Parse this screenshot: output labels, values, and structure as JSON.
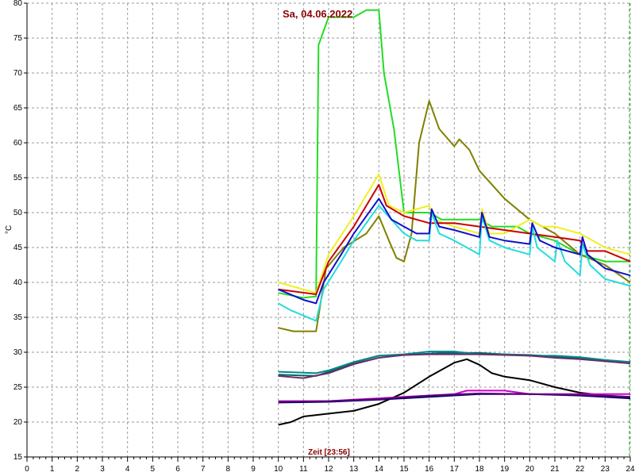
{
  "chart_data": {
    "type": "line",
    "title": "Sa, 04.06.2022",
    "xlabel": "Zeit [23:56]",
    "ylabel": "°C",
    "xlim": [
      0,
      24
    ],
    "ylim": [
      15,
      80
    ],
    "x_ticks": [
      0,
      1,
      2,
      3,
      4,
      5,
      6,
      7,
      8,
      9,
      10,
      11,
      12,
      13,
      14,
      15,
      16,
      17,
      18,
      19,
      20,
      21,
      22,
      23,
      24
    ],
    "y_ticks": [
      15,
      20,
      25,
      30,
      35,
      40,
      45,
      50,
      55,
      60,
      65,
      70,
      75,
      80
    ],
    "grid": true,
    "series": [
      {
        "color": "#22dd22",
        "points": [
          [
            10,
            38.5
          ],
          [
            11,
            37.8
          ],
          [
            11.5,
            38
          ],
          [
            11.6,
            74
          ],
          [
            11.9,
            77
          ],
          [
            12,
            78
          ],
          [
            13,
            78
          ],
          [
            13.5,
            79
          ],
          [
            14,
            79
          ],
          [
            14.2,
            70
          ],
          [
            14.6,
            62
          ],
          [
            15,
            50
          ],
          [
            16,
            50
          ],
          [
            16.5,
            49
          ],
          [
            17,
            49
          ],
          [
            18,
            49
          ],
          [
            18.5,
            48
          ],
          [
            19,
            48
          ],
          [
            19.5,
            48
          ],
          [
            20,
            47
          ],
          [
            21,
            46
          ],
          [
            22,
            44
          ],
          [
            23,
            43
          ],
          [
            24,
            43
          ]
        ]
      },
      {
        "color": "#808000",
        "points": [
          [
            10,
            33.5
          ],
          [
            10.6,
            33
          ],
          [
            11.5,
            33
          ],
          [
            11.9,
            42
          ],
          [
            12.6,
            45
          ],
          [
            13.5,
            47
          ],
          [
            14,
            49.5
          ],
          [
            14.4,
            46
          ],
          [
            14.7,
            43.5
          ],
          [
            15,
            43
          ],
          [
            15.3,
            47
          ],
          [
            15.6,
            60
          ],
          [
            16,
            66
          ],
          [
            16.4,
            62
          ],
          [
            17,
            59.5
          ],
          [
            17.2,
            60.5
          ],
          [
            17.6,
            59
          ],
          [
            18,
            56
          ],
          [
            19,
            52
          ],
          [
            20,
            49
          ],
          [
            21,
            47
          ],
          [
            22,
            44
          ],
          [
            23,
            42.5
          ],
          [
            24,
            40
          ]
        ]
      },
      {
        "color": "#f0f020",
        "points": [
          [
            10,
            40
          ],
          [
            11.5,
            38.5
          ],
          [
            12,
            44
          ],
          [
            13,
            49.5
          ],
          [
            14,
            55.5
          ],
          [
            14.4,
            51
          ],
          [
            15,
            50
          ],
          [
            16,
            51
          ],
          [
            16.2,
            49
          ],
          [
            17,
            48
          ],
          [
            18,
            47
          ],
          [
            18.1,
            50.5
          ],
          [
            18.4,
            47
          ],
          [
            19,
            47
          ],
          [
            20,
            49
          ],
          [
            20.5,
            48
          ],
          [
            21,
            48
          ],
          [
            22,
            47
          ],
          [
            23,
            45
          ],
          [
            24,
            44
          ]
        ]
      },
      {
        "color": "#cc0000",
        "points": [
          [
            10,
            39
          ],
          [
            11.5,
            38.3
          ],
          [
            12,
            43
          ],
          [
            13,
            48
          ],
          [
            14,
            54
          ],
          [
            14.3,
            51
          ],
          [
            15,
            49.5
          ],
          [
            16,
            48.5
          ],
          [
            17,
            48.5
          ],
          [
            18,
            48
          ],
          [
            19,
            47.5
          ],
          [
            20,
            47
          ],
          [
            21,
            46.5
          ],
          [
            22,
            46
          ],
          [
            22.3,
            44.5
          ],
          [
            23,
            44.5
          ],
          [
            24,
            43
          ]
        ]
      },
      {
        "color": "#22dddd",
        "points": [
          [
            10,
            37
          ],
          [
            10.5,
            36
          ],
          [
            11.5,
            34.5
          ],
          [
            11.8,
            39
          ],
          [
            12.5,
            43
          ],
          [
            13,
            46
          ],
          [
            14,
            51
          ],
          [
            14.5,
            49
          ],
          [
            15,
            47
          ],
          [
            15.5,
            46
          ],
          [
            16,
            46
          ],
          [
            16.1,
            50
          ],
          [
            16.4,
            47
          ],
          [
            17,
            46
          ],
          [
            18,
            44
          ],
          [
            18.1,
            49.5
          ],
          [
            18.4,
            46
          ],
          [
            19,
            45
          ],
          [
            20,
            44
          ],
          [
            20.1,
            48
          ],
          [
            20.3,
            45
          ],
          [
            21,
            43
          ],
          [
            21.1,
            46
          ],
          [
            21.4,
            43
          ],
          [
            22,
            41
          ],
          [
            22.1,
            45.5
          ],
          [
            22.4,
            42.5
          ],
          [
            23,
            40.5
          ],
          [
            24,
            39.5
          ]
        ]
      },
      {
        "color": "#1010cc",
        "points": [
          [
            10,
            39
          ],
          [
            11,
            37.5
          ],
          [
            11.5,
            37
          ],
          [
            11.8,
            40
          ],
          [
            12.5,
            44
          ],
          [
            13,
            47
          ],
          [
            14,
            52
          ],
          [
            14.5,
            49
          ],
          [
            15,
            48
          ],
          [
            15.5,
            47
          ],
          [
            16,
            47
          ],
          [
            16.1,
            50.5
          ],
          [
            16.4,
            48
          ],
          [
            17,
            47.5
          ],
          [
            18,
            46.5
          ],
          [
            18.1,
            50
          ],
          [
            18.4,
            46.5
          ],
          [
            19,
            46
          ],
          [
            20,
            45.5
          ],
          [
            20.1,
            48.5
          ],
          [
            20.4,
            46
          ],
          [
            21,
            45
          ],
          [
            22,
            44
          ],
          [
            22.1,
            46.5
          ],
          [
            22.3,
            44
          ],
          [
            23,
            42
          ],
          [
            24,
            41
          ]
        ]
      },
      {
        "color": "#006666",
        "points": [
          [
            10,
            26.8
          ],
          [
            11.5,
            26.6
          ],
          [
            12,
            27.2
          ],
          [
            13,
            28.5
          ],
          [
            14,
            29.5
          ],
          [
            15,
            29.6
          ],
          [
            16,
            29.8
          ],
          [
            16.5,
            29.9
          ],
          [
            17,
            29.9
          ],
          [
            18,
            29.9
          ],
          [
            19,
            29.7
          ],
          [
            20,
            29.6
          ],
          [
            21,
            29.4
          ],
          [
            22,
            29.1
          ],
          [
            23,
            28.8
          ],
          [
            24,
            28.5
          ]
        ]
      },
      {
        "color": "#008888",
        "points": [
          [
            10,
            27.2
          ],
          [
            11.5,
            27
          ],
          [
            12,
            27.4
          ],
          [
            13,
            28.6
          ],
          [
            14,
            29.5
          ],
          [
            15,
            29.7
          ],
          [
            16,
            30.1
          ],
          [
            17,
            30.1
          ],
          [
            18,
            29.7
          ],
          [
            19,
            29.7
          ],
          [
            20,
            29.5
          ],
          [
            21,
            29.5
          ],
          [
            22,
            29.3
          ],
          [
            23,
            28.9
          ],
          [
            24,
            28.6
          ]
        ]
      },
      {
        "color": "#6a2d6a",
        "points": [
          [
            10,
            26.6
          ],
          [
            11,
            26.3
          ],
          [
            12,
            27
          ],
          [
            13,
            28.3
          ],
          [
            14,
            29.2
          ],
          [
            15,
            29.6
          ],
          [
            16,
            29.7
          ],
          [
            17,
            29.7
          ],
          [
            18,
            29.7
          ],
          [
            19,
            29.6
          ],
          [
            20,
            29.5
          ],
          [
            21,
            29.2
          ],
          [
            22,
            29
          ],
          [
            23,
            28.7
          ],
          [
            24,
            28.4
          ]
        ]
      },
      {
        "color": "#000000",
        "points": [
          [
            10,
            19.6
          ],
          [
            10.5,
            20
          ],
          [
            11,
            20.8
          ],
          [
            12,
            21.2
          ],
          [
            13,
            21.6
          ],
          [
            14,
            22.6
          ],
          [
            15,
            24.2
          ],
          [
            16,
            26.5
          ],
          [
            17,
            28.5
          ],
          [
            17.5,
            29
          ],
          [
            18,
            28.2
          ],
          [
            18.5,
            27
          ],
          [
            19,
            26.5
          ],
          [
            20,
            26
          ],
          [
            21,
            25
          ],
          [
            22,
            24.2
          ],
          [
            23,
            23.8
          ],
          [
            24,
            23.6
          ]
        ]
      },
      {
        "color": "#cc00cc",
        "points": [
          [
            10,
            23
          ],
          [
            11,
            23
          ],
          [
            12,
            23
          ],
          [
            13,
            23.2
          ],
          [
            14,
            23.4
          ],
          [
            15,
            23.6
          ],
          [
            16,
            23.8
          ],
          [
            17,
            24
          ],
          [
            17.5,
            24.5
          ],
          [
            19,
            24.5
          ],
          [
            20,
            24
          ],
          [
            21,
            24
          ],
          [
            22,
            24
          ],
          [
            23,
            24
          ],
          [
            24,
            24
          ]
        ]
      },
      {
        "color": "#000066",
        "points": [
          [
            10,
            22.8
          ],
          [
            12,
            22.9
          ],
          [
            14,
            23.2
          ],
          [
            16,
            23.6
          ],
          [
            18,
            24
          ],
          [
            20,
            24
          ],
          [
            22,
            23.8
          ],
          [
            24,
            23.4
          ]
        ]
      },
      {
        "color": "#5a0078",
        "points": [
          [
            10,
            22.9
          ],
          [
            12,
            23
          ],
          [
            14,
            23.3
          ],
          [
            16,
            23.8
          ],
          [
            18,
            24.1
          ],
          [
            20,
            24
          ],
          [
            22,
            23.9
          ],
          [
            24,
            23.6
          ]
        ]
      }
    ]
  }
}
